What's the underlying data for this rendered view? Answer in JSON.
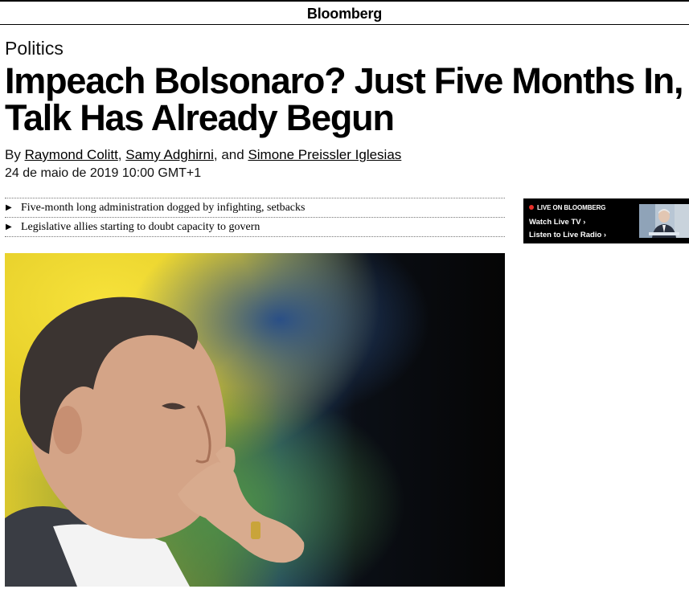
{
  "header": {
    "brand": "Bloomberg"
  },
  "article": {
    "kicker": "Politics",
    "headline": "Impeach Bolsonaro? Just Five Months In, Talk Has Already Begun",
    "byline": {
      "prefix": "By",
      "authors": [
        "Raymond Colitt",
        "Samy Adghirni",
        "Simone Preissler Iglesias"
      ],
      "sep1": ",",
      "sep2": ", and"
    },
    "date": "24 de maio de 2019 10:00 GMT+1",
    "abstract": [
      "Five-month long administration dogged by infighting, setbacks",
      "Legislative allies starting to doubt capacity to govern"
    ]
  },
  "live_widget": {
    "heading": "LIVE ON BLOOMBERG",
    "watch_label": "Watch Live TV",
    "listen_label": "Listen to Live Radio",
    "arrow": "›",
    "accent_color": "#e8302a"
  },
  "icons": {
    "bullet": "▶",
    "bullet_name": "triangle-right-icon"
  }
}
